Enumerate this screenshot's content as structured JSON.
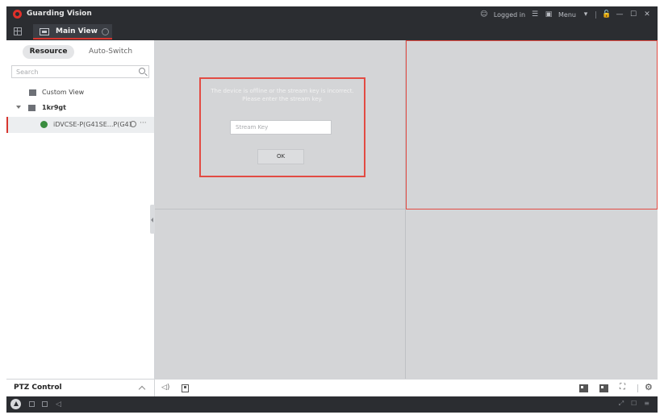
{
  "app": {
    "title": "Guarding Vision",
    "status": "Logged in",
    "menu_label": "Menu",
    "controls": {
      "list": "☰",
      "image": "▣",
      "menu_caret": "▾",
      "lock": "🔓",
      "minimize": "—",
      "maximize": "☐",
      "close": "✕"
    }
  },
  "tabs": [
    {
      "label": "Main View"
    }
  ],
  "sidebar": {
    "segments": {
      "resource": "Resource",
      "auto_switch": "Auto-Switch"
    },
    "search_placeholder": "Search",
    "tree": {
      "custom_view": "Custom View",
      "group": "1kr9gt",
      "device": "iDVCSE-P(G41SE...P(G41"
    },
    "more": "···"
  },
  "dialog": {
    "message": "The device is offline or the stream key is incorrect. Please enter the stream key.",
    "input_placeholder": "Stream Key",
    "ok_label": "OK"
  },
  "ptz": {
    "label": "PTZ Control"
  },
  "view_toolbar": {
    "volume": "◁)",
    "fullscreen": "⛶",
    "settings": "⚙"
  },
  "statusbar": {
    "audio": "◁",
    "right_icons": [
      "⤢",
      "☐",
      "≡"
    ]
  },
  "colors": {
    "chrome": "#2b2d31",
    "accent": "#d7362f",
    "grid_bg": "#d4d5d7",
    "device_online": "#3a8d3f"
  }
}
